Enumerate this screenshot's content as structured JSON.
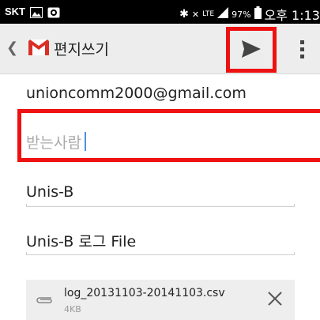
{
  "status_bar": {
    "carrier": "SKT",
    "battery_pct": "97%",
    "clock": "오후 1:13",
    "network": "LTE"
  },
  "action_bar": {
    "title": "편지쓰기"
  },
  "compose": {
    "from": "unioncomm2000@gmail.com",
    "to_placeholder": "받는사람",
    "subject": "Unis-B",
    "body": "Unis-B 로그 File"
  },
  "attachment": {
    "filename": "log_20131103-20141103.csv",
    "size": "4KB"
  },
  "colors": {
    "gmail_red": "#d93025",
    "highlight_red": "#ee1111",
    "caret_blue": "#4a90e2"
  }
}
